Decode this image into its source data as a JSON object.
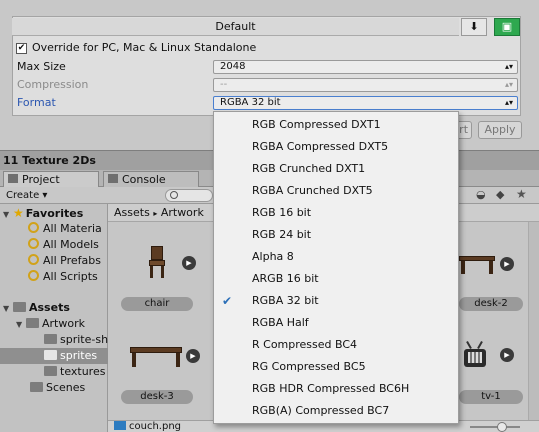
{
  "inspector": {
    "header": "Default",
    "override_label": "Override for PC, Mac & Linux Standalone",
    "override_checked": true,
    "max_size_label": "Max Size",
    "max_size_value": "2048",
    "compression_label": "Compression",
    "compression_value": "--",
    "format_label": "Format",
    "format_value": "RGBA 32 bit",
    "revert_label": "Revert",
    "apply_label": "Apply",
    "download_icon": "download-icon",
    "platform_icon": "android-icon"
  },
  "window_title": "11 Texture 2Ds",
  "tabs": [
    {
      "label": "Project",
      "icon": "project-icon"
    },
    {
      "label": "Console",
      "icon": "console-icon"
    }
  ],
  "toolbar": {
    "create_label": "Create ▾"
  },
  "tree": {
    "favorites_label": "Favorites",
    "favorites": [
      "All Materia",
      "All Models",
      "All Prefabs",
      "All Scripts"
    ],
    "assets_label": "Assets",
    "artwork_label": "Artwork",
    "children": [
      "sprite-sh",
      "sprites",
      "textures"
    ],
    "scenes_label": "Scenes"
  },
  "breadcrumb": {
    "root": "Assets",
    "sep": "▸",
    "current": "Artwork"
  },
  "assets": [
    "chair",
    "desk-2",
    "desk-3",
    "tv-1"
  ],
  "status_file": "couch.png",
  "format_menu": {
    "selected": "RGBA 32 bit",
    "items": [
      "RGB Compressed DXT1",
      "RGBA Compressed DXT5",
      "RGB Crunched DXT1",
      "RGBA Crunched DXT5",
      "RGB 16 bit",
      "RGB 24 bit",
      "Alpha 8",
      "ARGB 16 bit",
      "RGBA 32 bit",
      "RGBA Half",
      "R Compressed BC4",
      "RG Compressed BC5",
      "RGB HDR Compressed BC6H",
      "RGB(A) Compressed BC7"
    ]
  },
  "colors": {
    "accent": "#2b6fb7",
    "android": "#18a34a",
    "selected_tree": "#8f8f8f"
  }
}
